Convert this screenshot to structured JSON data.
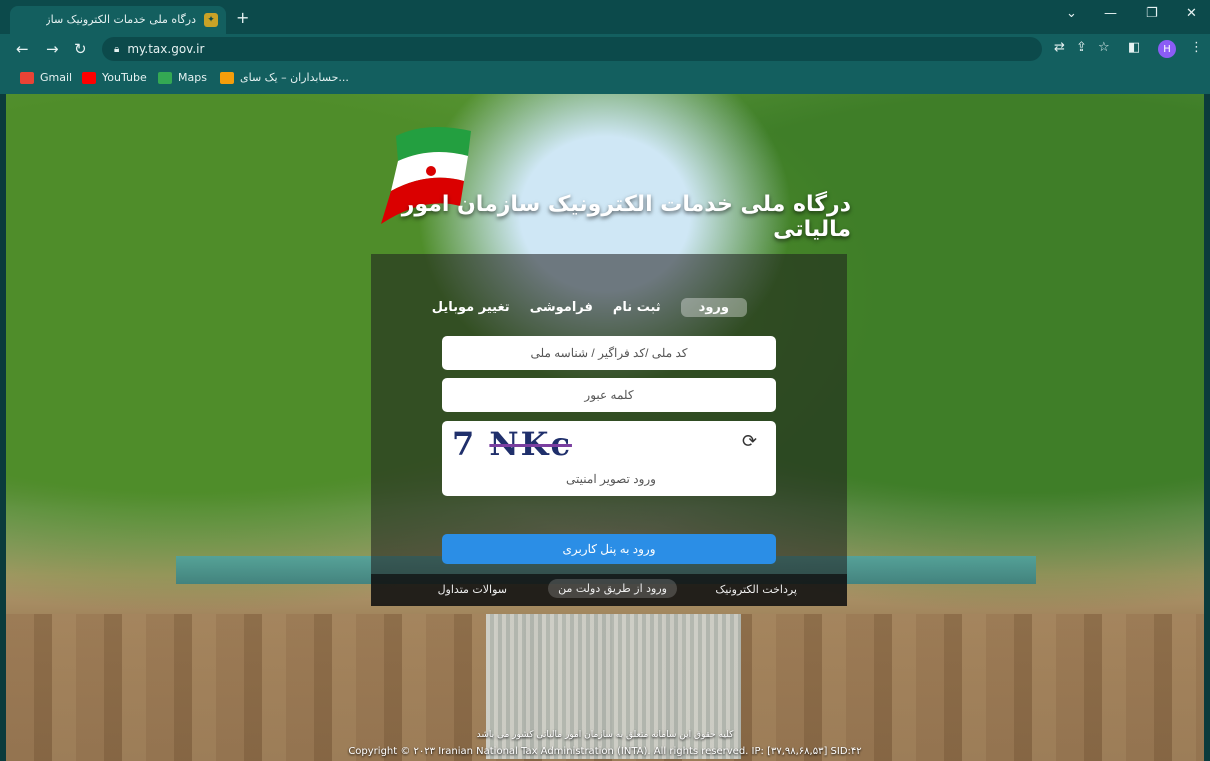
{
  "browser": {
    "tab_title": "درگاه ملی خدمات الکترونیک سازمان",
    "url": "my.tax.gov.ir",
    "profile_initial": "H",
    "bookmarks": [
      {
        "label": "Gmail",
        "icon": "gmail-icon",
        "color": "#ea4335"
      },
      {
        "label": "YouTube",
        "icon": "youtube-icon",
        "color": "#ff0000"
      },
      {
        "label": "Maps",
        "icon": "maps-icon",
        "color": "#34a853"
      },
      {
        "label": "حسابداران – یک سای...",
        "icon": "site-icon",
        "color": "#f59e0b"
      }
    ]
  },
  "portal": {
    "title": "درگاه ملی خدمات الکترونیک سازمان امور مالیاتی",
    "tabs": {
      "login": "ورود",
      "register": "ثبت نام",
      "forgot": "فراموشی",
      "change_mobile": "تغییر موبایل"
    },
    "username_placeholder": "کد ملی /کد فراگیر / شناسه ملی",
    "password_placeholder": "کلمه عبور",
    "captcha": {
      "text_a": "7",
      "text_b": "NKc",
      "placeholder": "ورود تصویر امنیتی"
    },
    "login_button": "ورود به پنل کاربری",
    "footer": {
      "epayment": "پرداخت الکترونیک",
      "my_gov": "ورود از طریق دولت من",
      "faq": "سوالات متداول"
    },
    "rights_text": "کلیه حقوق این سامانه متعلق به سازمان امور مالیاتی کشور می باشد",
    "copyright": "Copyright © ۲۰۲۳ Iranian National Tax Administration (INTA). All rights reserved. IP: [۳۷,۹۸,۶۸,۵۳] SID:۴۲"
  },
  "colors": {
    "accent": "#2b8ee6",
    "browser_bg": "#135f5f"
  }
}
